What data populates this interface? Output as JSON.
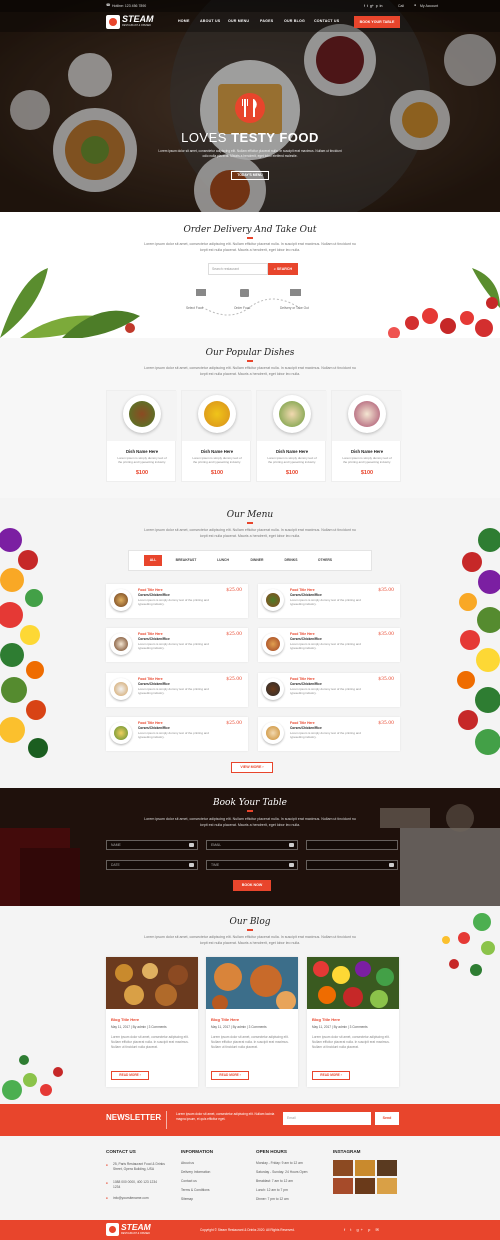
{
  "topbar": {
    "hotline": "Hotline: 123 456 7890",
    "call": "Cali",
    "account": "My Account"
  },
  "brand": {
    "name": "STEAM",
    "tagline": "RESTAURANT & OPENED"
  },
  "nav": {
    "items": [
      "HOME",
      "ABOUT US",
      "OUR MENU",
      "PAGES",
      "OUR BLOG",
      "CONTACT US"
    ],
    "cta": "BOOK YOUR TABLE"
  },
  "hero": {
    "title_a": "LOVES",
    "title_b": "TESTY FOOD",
    "text1": "Lorem ipsum dolor sit amet, consectetur adipiscing elit. Nullam efficitur placerat nulla. In suscipit erat maximus. Nullam ut tincidunt",
    "text2": "odio nulla placerat. Mauris a hendrerit, eget lobor eleifend molestie.",
    "button": "TODAY'S MENU"
  },
  "delivery": {
    "title": "Order Delivery And Take Out",
    "text1": "Lorem ipsum dolor sit amet, consectetur adipiscing elit. Nullam efficitur placerat nulla. In suscipit erat maximus. Nullam ut tincidunt nu",
    "text2": "lorpit est nulla placerat. Mauris a hendrerit, eget lobor leo nulla.",
    "search_placeholder": "Search restaurant",
    "search_button": "SEARCH",
    "steps": [
      "Select Food",
      "Order Food",
      "Delivery or Take Out"
    ]
  },
  "popular": {
    "title": "Our Popular Dishes",
    "text1": "Lorem ipsum dolor sit amet, consectetur adipiscing elit. Nullam efficitur placerat nulla. In suscipit erat maximus. Nullam ut tincidunt nu",
    "text2": "lorpit est nulla placerat. Mauris a hendrerit, eget lobor leo nulla.",
    "dishes": [
      {
        "name": "Dish Name Here",
        "desc": "Lorem ipsum is simply dummy text of the printing and typesetting industry.",
        "price": "$100"
      },
      {
        "name": "Dish Name Here",
        "desc": "Lorem ipsum is simply dummy text of the printing and typesetting industry.",
        "price": "$100"
      },
      {
        "name": "Dish Name Here",
        "desc": "Lorem ipsum is simply dummy text of the printing and typesetting industry.",
        "price": "$100"
      },
      {
        "name": "Dish Name Here",
        "desc": "Lorem ipsum is simply dummy text of the printing and typesetting industry.",
        "price": "$100"
      }
    ]
  },
  "menu": {
    "title": "Our Menu",
    "text1": "Lorem ipsum dolor sit amet, consectetur adipiscing elit. Nullam efficitur placerat nulla. In suscipit erat maximus. Nullam ut tincidunt nu",
    "text2": "lorpit est nulla placerat. Mauris a hendrerit, eget lobor leo nulla.",
    "tabs": [
      "ALL",
      "BREAKFAST",
      "LUNCH",
      "DINNER",
      "DRINKS",
      "OTHERS"
    ],
    "items": [
      {
        "title": "Food Title Here",
        "sub": "Corses/Chicken/Rice",
        "desc": "Lorem ipsum is simply dummy text of the printing and typesetting industry.",
        "price": "$25.00"
      },
      {
        "title": "Food Title Here",
        "sub": "Corses/Chicken/Rice",
        "desc": "Lorem ipsum is simply dummy text of the printing and typesetting industry.",
        "price": "$35.00"
      },
      {
        "title": "Food Title Here",
        "sub": "Corses/Chicken/Rice",
        "desc": "Lorem ipsum is simply dummy text of the printing and typesetting industry.",
        "price": "$25.00"
      },
      {
        "title": "Food Title Here",
        "sub": "Corses/Chicken/Rice",
        "desc": "Lorem ipsum is simply dummy text of the printing and typesetting industry.",
        "price": "$35.00"
      },
      {
        "title": "Food Title Here",
        "sub": "Corses/Chicken/Rice",
        "desc": "Lorem ipsum is simply dummy text of the printing and typesetting industry.",
        "price": "$25.00"
      },
      {
        "title": "Food Title Here",
        "sub": "Corses/Chicken/Rice",
        "desc": "Lorem ipsum is simply dummy text of the printing and typesetting industry.",
        "price": "$35.00"
      },
      {
        "title": "Food Title Here",
        "sub": "Corses/Chicken/Rice",
        "desc": "Lorem ipsum is simply dummy text of the printing and typesetting industry.",
        "price": "$25.00"
      },
      {
        "title": "Food Title Here",
        "sub": "Corses/Chicken/Rice",
        "desc": "Lorem ipsum is simply dummy text of the printing and typesetting industry.",
        "price": "$35.00"
      }
    ],
    "view_more": "VIEW MORE"
  },
  "book": {
    "title": "Book Your Table",
    "text1": "Lorem ipsum dolor sit amet, consectetur adipiscing elit. Nullam efficitur placerat nulla. In suscipit erat maximus. Nullam ut tincidunt nu",
    "text2": "lorpit est nulla placerat. Mauris a hendrerit, eget lobor leo nulla.",
    "fields": [
      "NAME",
      "EMAIL",
      "",
      "DATE",
      "TIME",
      ""
    ],
    "button": "BOOK NOW"
  },
  "blog": {
    "title": "Our Blog",
    "text1": "Lorem ipsum dolor sit amet, consectetur adipiscing elit. Nullam efficitur placerat nulla. In suscipit erat maximus. Nullam ut tincidunt nu",
    "text2": "lorpit est nulla placerat. Mauris a hendrerit, eget lobor leo nulla.",
    "posts": [
      {
        "title": "Blog Title Here",
        "meta": "May 11, 2017 | By admin | 3 Comments",
        "desc": "Lorem ipsum dolor sit amet, consectetur adipiscing elit. Nullam efficitur placerat nulla. In suscipit erat maximus. Nullam ut tincidunt nulla placerat.",
        "more": "READ MORE"
      },
      {
        "title": "Blog Title Here",
        "meta": "May 11, 2017 | By admin | 3 Comments",
        "desc": "Lorem ipsum dolor sit amet, consectetur adipiscing elit. Nullam efficitur placerat nulla. In suscipit erat maximus. Nullam ut tincidunt nulla placerat.",
        "more": "READ MORE"
      },
      {
        "title": "Blog Title Here",
        "meta": "May 11, 2017 | By admin | 3 Comments",
        "desc": "Lorem ipsum dolor sit amet, consectetur adipiscing elit. Nullam efficitur placerat nulla. In suscipit erat maximus. Nullam ut tincidunt nulla placerat.",
        "more": "READ MORE"
      }
    ]
  },
  "newsletter": {
    "title": "NEWSLETTER",
    "text": "Lorem ipsum dolor sit amet, consectetur adipiscing elit. Nullam lacinia magna ipsum, et quis efficitur eget.",
    "placeholder": "Email",
    "button": "Send"
  },
  "footer": {
    "contact": {
      "title": "CONTACT US",
      "address": "25, Paris Restaurant Food & Drinks Street, Opera Building, USA",
      "phone": "1088 000 0000, 400 123 1234 1234",
      "email": "info@yoursitename.com"
    },
    "info": {
      "title": "INFORMATION",
      "links": [
        "About us",
        "Delivery Information",
        "Contact us",
        "Terms & Conditions",
        "Sitemap"
      ]
    },
    "hours": {
      "title": "OPEN HOURS",
      "rows": [
        "Monday - Friday: 9 am to 12 am",
        "Saturday - Sunday: 24 Hours Open",
        "Breakfast: 7 am to 12 am",
        "Lunch: 12 am to 7 pm",
        "Dinner: 7 pm to 12 am"
      ]
    },
    "instagram": {
      "title": "INSTAGRAM"
    },
    "copyright": "Copyright © Steam Restaurant & Drinks 2020. All Rights Reserved."
  },
  "colors": {
    "accent": "#e8452c",
    "dark": "#222222"
  }
}
